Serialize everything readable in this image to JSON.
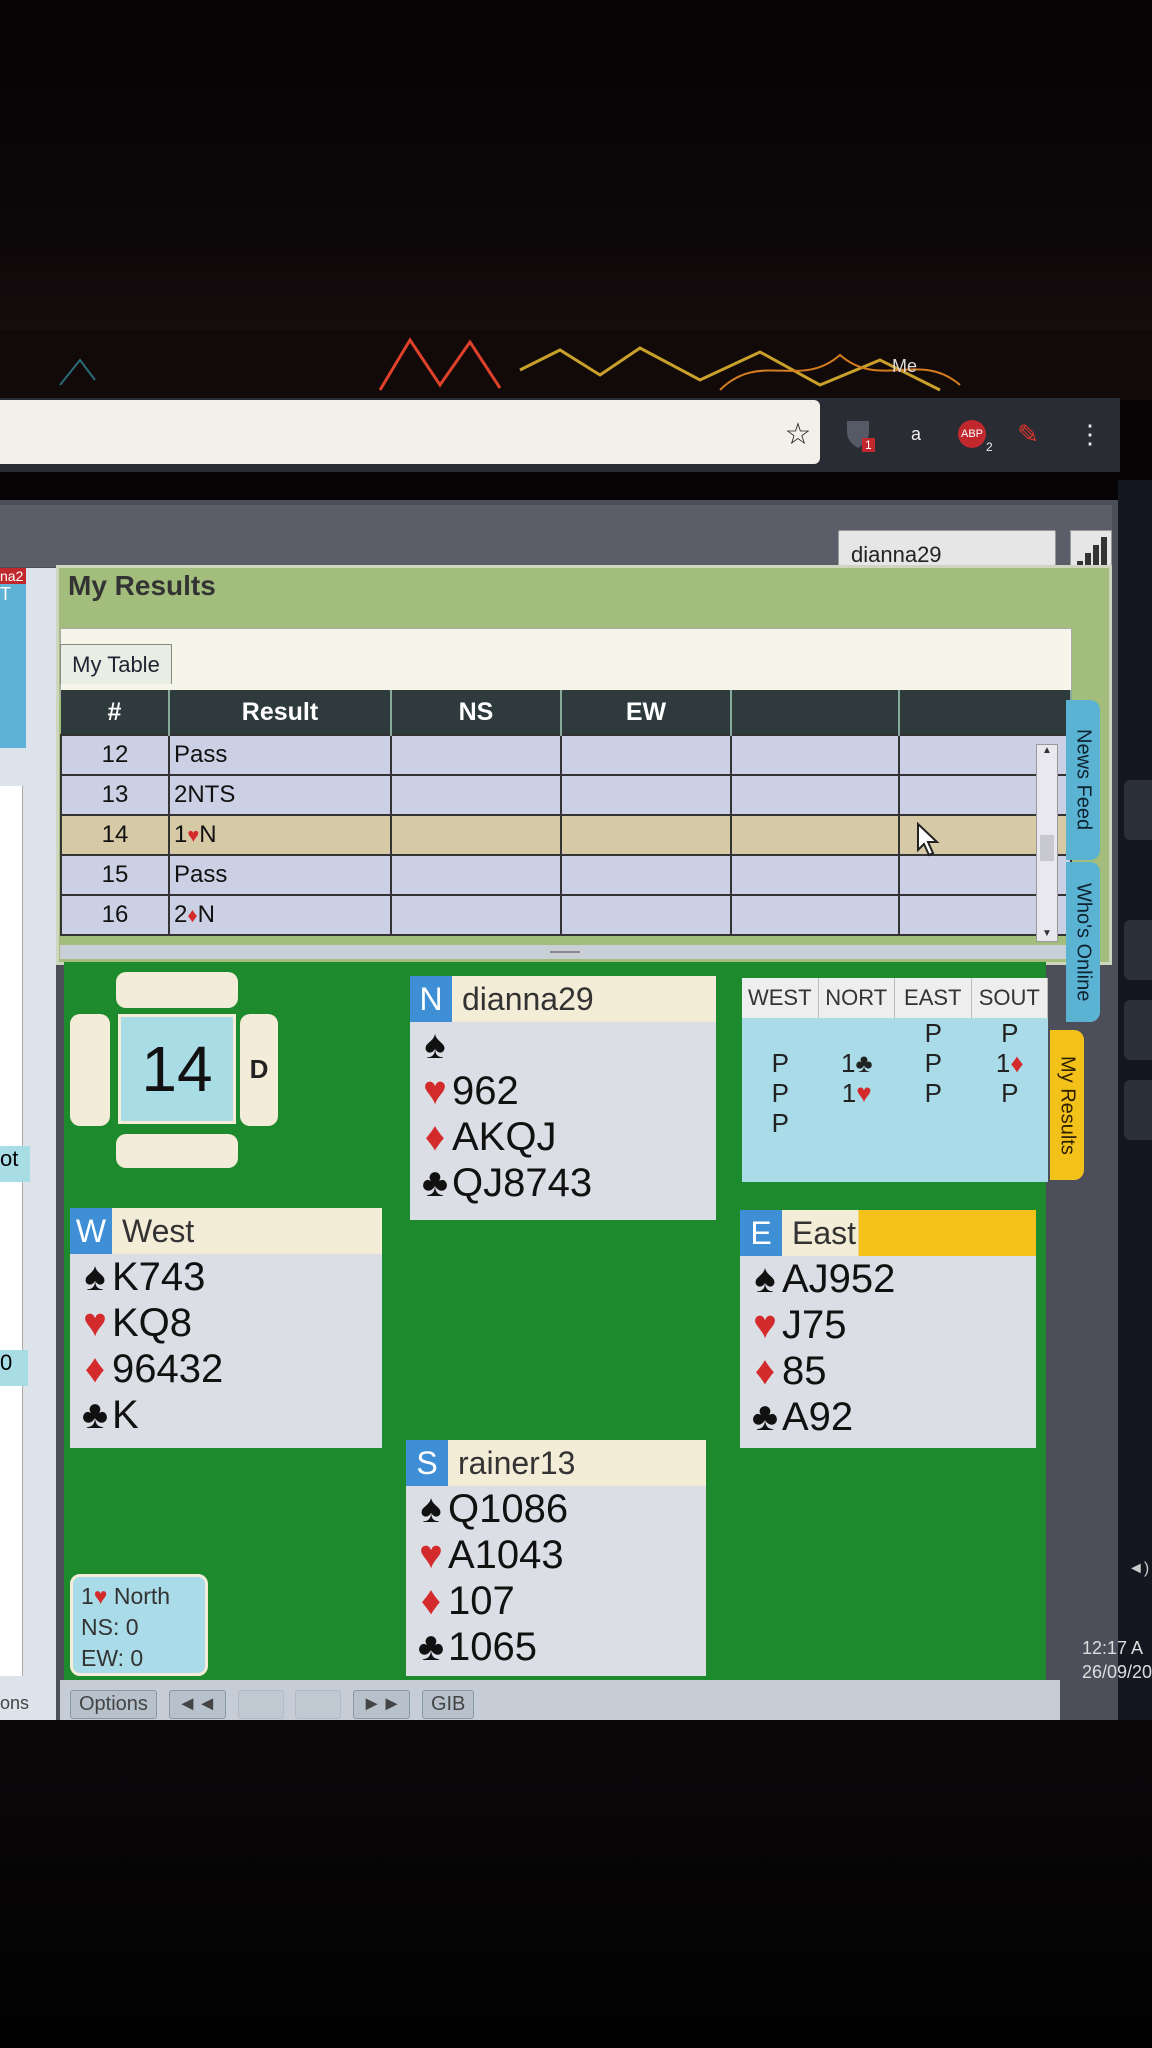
{
  "browser": {
    "ext_badge_1": "1",
    "ext_letter": "a",
    "ext_abp": "ABP",
    "ext_abp_count": "2",
    "wallpaper_text": "Me"
  },
  "header": {
    "username": "dianna29"
  },
  "results": {
    "title": "My Results",
    "tab_label": "My Table",
    "columns": [
      "#",
      "Result",
      "NS",
      "EW",
      "",
      ""
    ],
    "rows": [
      {
        "num": "12",
        "result": "Pass"
      },
      {
        "num": "13",
        "result": "2NTS"
      },
      {
        "num": "14",
        "result_level": "1",
        "result_suit": "♥",
        "result_rest": "N",
        "selected": true
      },
      {
        "num": "15",
        "result": "Pass"
      },
      {
        "num": "16",
        "result_level": "2",
        "result_suit": "♦",
        "result_rest": "N"
      }
    ]
  },
  "side_tabs": {
    "news": "News Feed",
    "online": "Who's Online",
    "results": "My Results"
  },
  "board": {
    "number": "14",
    "dealer_tag": "D"
  },
  "hands": {
    "north": {
      "seat": "N",
      "player": "dianna29",
      "spades": "",
      "hearts": "962",
      "diamonds": "AKQJ",
      "clubs": "QJ8743"
    },
    "west": {
      "seat": "W",
      "player": "West",
      "spades": "K743",
      "hearts": "KQ8",
      "diamonds": "96432",
      "clubs": "K"
    },
    "east": {
      "seat": "E",
      "player": "East",
      "spades": "AJ952",
      "hearts": "J75",
      "diamonds": "85",
      "clubs": "A92"
    },
    "south": {
      "seat": "S",
      "player": "rainer13",
      "spades": "Q1086",
      "hearts": "A1043",
      "diamonds": "107",
      "clubs": "1065"
    }
  },
  "bidding": {
    "headers": [
      "WEST",
      "NORT",
      "EAST",
      "SOUT"
    ],
    "rows": [
      [
        "",
        "",
        "P",
        "P"
      ],
      [
        "P",
        "1♣",
        "P",
        "1♦"
      ],
      [
        "P",
        "1♥",
        "P",
        "P"
      ],
      [
        "P",
        "",
        "",
        ""
      ]
    ]
  },
  "score": {
    "contract_level": "1",
    "contract_suit": "♥",
    "declarer": "North",
    "ns": "NS: 0",
    "ew": "EW: 0"
  },
  "controls": {
    "options": "Options",
    "rewind": "◄◄",
    "forward": "►►",
    "gib": "GIB"
  },
  "left_panel": {
    "frag1": "na2",
    "frag2": "T",
    "frag3": "ot",
    "frag4": "0",
    "frag5": "ons"
  },
  "clock": {
    "time": "12:17 A",
    "date": "26/09/20"
  },
  "colors": {
    "felt": "#1d8b2d",
    "seat_blue": "#3f8fd6",
    "highlight_yellow": "#f2c21a",
    "red_suit": "#d32b2b"
  }
}
